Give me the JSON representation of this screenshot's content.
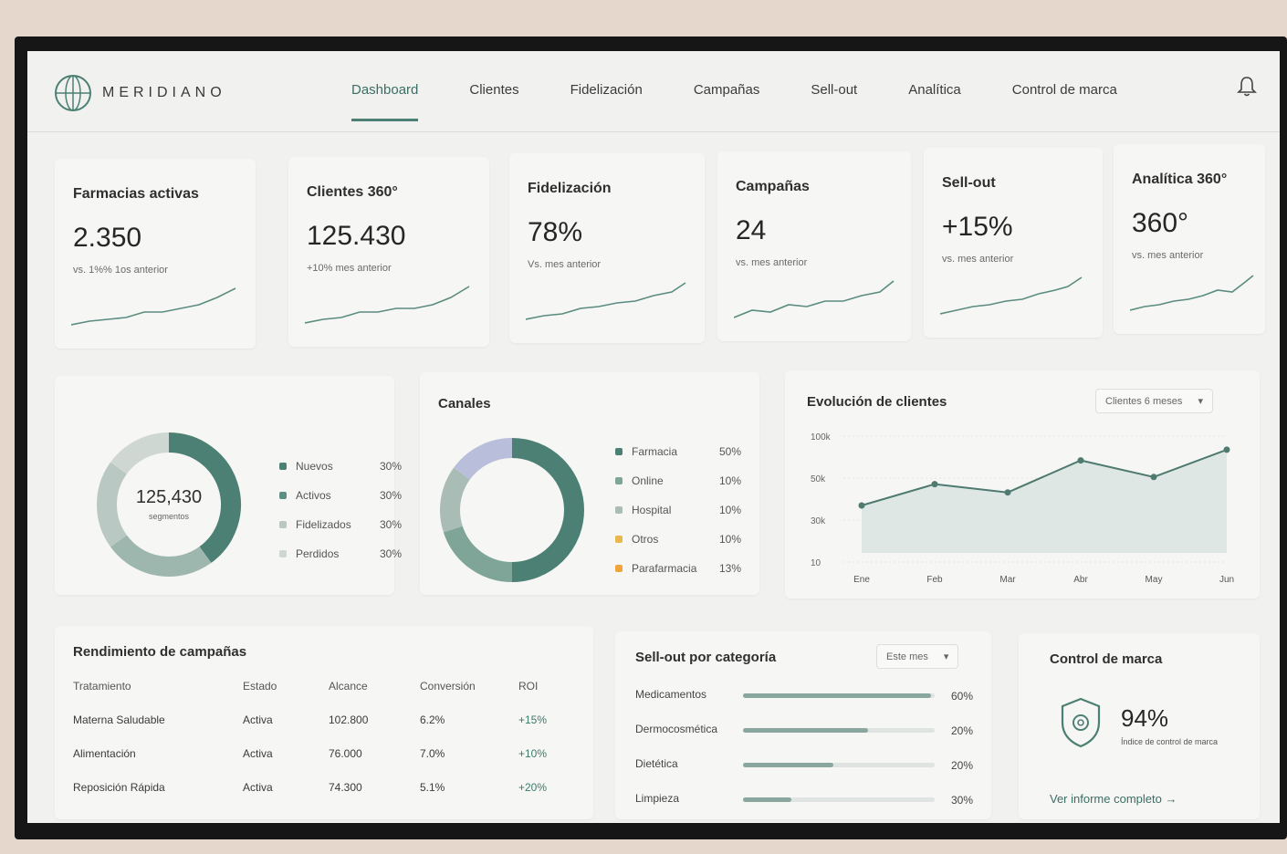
{
  "brand": {
    "name": "MERIDIANO",
    "accent": "#4c8074"
  },
  "nav": {
    "items": [
      {
        "label": "Dashboard",
        "active": true
      },
      {
        "label": "Clientes"
      },
      {
        "label": "Fidelización"
      },
      {
        "label": "Campañas"
      },
      {
        "label": "Sell-out"
      },
      {
        "label": "Analítica"
      },
      {
        "label": "Control de marca"
      }
    ],
    "bell_icon": "bell-icon"
  },
  "kpis": [
    {
      "title": "Farmacias activas",
      "value": "2.350",
      "sub": "vs. 1%% 1os anterior"
    },
    {
      "title": "Clientes 360°",
      "value": "125.430",
      "sub": "+10% mes anterior"
    },
    {
      "title": "Fidelización",
      "value": "78%",
      "sub": "Vs. mes anterior"
    },
    {
      "title": "Campañas",
      "value": "24",
      "sub": "vs. mes anterior"
    },
    {
      "title": "Sell-out",
      "value": "+15%",
      "sub": "vs. mes anterior"
    },
    {
      "title": "Analítica 360°",
      "value": "360°",
      "sub": "vs. mes anterior"
    }
  ],
  "donut_clients": {
    "center_value": "125,430",
    "center_sub": "segmentos",
    "segments": [
      {
        "label": "Nuevos",
        "pct": "30%",
        "value": 40,
        "color": "#4c8074"
      },
      {
        "label": "Activos",
        "pct": "30%",
        "value": 25,
        "color": "#9eb7ae"
      },
      {
        "label": "Fidelizados",
        "pct": "30%",
        "value": 20,
        "color": "#b9c8c2"
      },
      {
        "label": "Perdidos",
        "pct": "30%",
        "value": 15,
        "color": "#cfd7d3"
      }
    ]
  },
  "canales": {
    "title": "Canales",
    "segments": [
      {
        "label": "Farmacia",
        "pct": "50%",
        "value": 50,
        "color": "#4c8074"
      },
      {
        "label": "Online",
        "pct": "10%",
        "value": 20,
        "color": "#7fa598"
      },
      {
        "label": "Hospital",
        "pct": "10%",
        "value": 15,
        "color": "#a9bdb6"
      },
      {
        "label": "Otros",
        "pct": "10%",
        "value": 15,
        "color": "#b9bedb"
      },
      {
        "label": "Parafarmacia",
        "pct": "13%",
        "value": 0,
        "color": "#e8b84a"
      }
    ]
  },
  "evolucion": {
    "title": "Evolución de clientes",
    "select": "Clientes 6 meses",
    "chart_data": {
      "type": "area",
      "x": [
        "Ene",
        "Feb",
        "Mar",
        "Abr",
        "May",
        "Jun"
      ],
      "y": [
        40,
        58,
        51,
        78,
        64,
        87
      ],
      "yticks": [
        "100k",
        "50k",
        "30k",
        "10"
      ],
      "ylim": [
        0,
        100
      ]
    }
  },
  "campanas": {
    "title": "Rendimiento de campañas",
    "columns": [
      "Tratamiento",
      "Estado",
      "Alcance",
      "Conversión",
      "ROI"
    ],
    "rows": [
      [
        "Materna Saludable",
        "Activa",
        "102.800",
        "6.2%",
        "+15%"
      ],
      [
        "Alimentación",
        "Activa",
        "76.000",
        "7.0%",
        "+10%"
      ],
      [
        "Reposición Rápida",
        "Activa",
        "74.300",
        "5.1%",
        "+20%"
      ]
    ]
  },
  "sellout": {
    "title": "Sell-out por categoría",
    "select": "Este mes",
    "bars": [
      {
        "label": "Medicamentos",
        "pct": "60%",
        "value": 0.98
      },
      {
        "label": "Dermocosmética",
        "pct": "20%",
        "value": 0.65
      },
      {
        "label": "Dietética",
        "pct": "20%",
        "value": 0.47
      },
      {
        "label": "Limpieza",
        "pct": "30%",
        "value": 0.25
      }
    ]
  },
  "control": {
    "title": "Control de marca",
    "value": "94%",
    "sub": "Índice de control de marca",
    "link": "Ver informe completo →"
  }
}
